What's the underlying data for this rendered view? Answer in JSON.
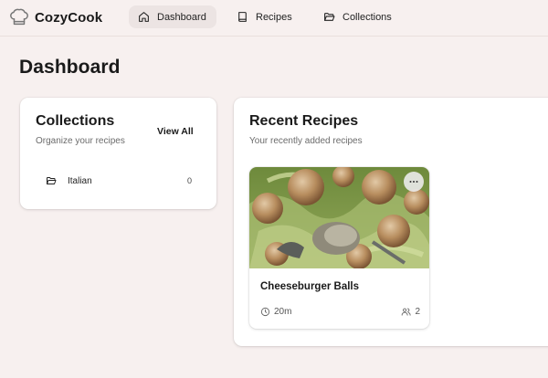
{
  "brand": {
    "name": "CozyCook",
    "logo": "chef-hat-icon"
  },
  "nav": {
    "items": [
      {
        "label": "Dashboard",
        "icon": "home-icon",
        "active": true
      },
      {
        "label": "Recipes",
        "icon": "book-icon",
        "active": false
      },
      {
        "label": "Collections",
        "icon": "folder-open-icon",
        "active": false
      }
    ]
  },
  "page": {
    "title": "Dashboard"
  },
  "collections_card": {
    "title": "Collections",
    "subtitle": "Organize your recipes",
    "view_all": "View All",
    "items": [
      {
        "name": "Italian",
        "count": "0",
        "icon": "folder-open-icon"
      }
    ]
  },
  "recent_card": {
    "title": "Recent Recipes",
    "subtitle": "Your recently added recipes",
    "recipes": [
      {
        "title": "Cheeseburger Balls",
        "time": "20m",
        "servings": "2",
        "more_icon": "more-horizontal-icon"
      }
    ]
  },
  "colors": {
    "background": "#f7f0ef",
    "active_nav": "#ece4e3",
    "card": "#ffffff",
    "muted_text": "#6b6b6b"
  }
}
